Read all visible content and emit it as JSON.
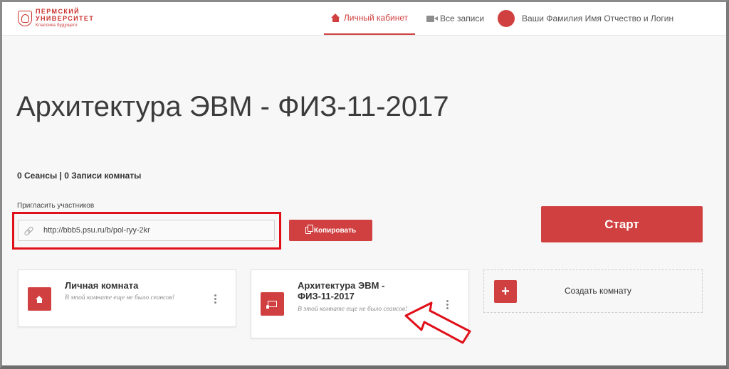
{
  "header": {
    "logo": {
      "line1": "ПЕРМСКИЙ",
      "line2": "УНИВЕРСИТЕТ",
      "line3": "Классика будущего"
    },
    "nav": {
      "cabinet": "Личный кабинет",
      "records": "Все записи",
      "user": "Ваши Фамилия Имя Отчество и Логин"
    }
  },
  "room": {
    "title": "Архитектура ЭВМ - ФИЗ-11-2017",
    "stats": "0 Сеансы | 0 Записи комнаты",
    "invite_label": "Пригласить участников",
    "invite_url": "http://bbb5.psu.ru/b/pol-ryy-2kr",
    "copy_label": "Копировать",
    "start_label": "Старт"
  },
  "cards": [
    {
      "title": "Личная комната",
      "subtitle": "В этой комнате еще не было сеансов!",
      "icon": "home-icon"
    },
    {
      "title": "Архитектура ЭВМ - ФИЗ-11-2017",
      "subtitle": "В этой комнате еще не было сеансов!",
      "icon": "presentation-icon"
    }
  ],
  "create_room": {
    "label": "Создать комнату",
    "icon_glyph": "+"
  },
  "colors": {
    "accent": "#d14040",
    "highlight": "#e0101a"
  }
}
